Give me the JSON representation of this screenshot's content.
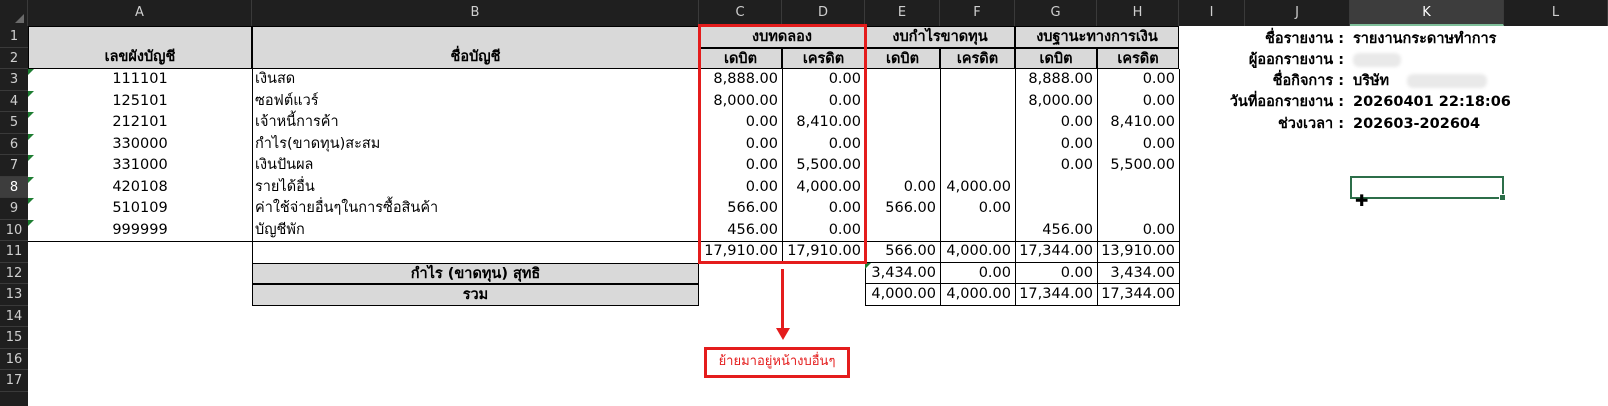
{
  "columns": [
    "A",
    "B",
    "C",
    "D",
    "E",
    "F",
    "G",
    "H",
    "I",
    "J",
    "K",
    "L"
  ],
  "rows": [
    "1",
    "2",
    "3",
    "4",
    "5",
    "6",
    "7",
    "8",
    "9",
    "10",
    "11",
    "12",
    "13",
    "14",
    "15",
    "16",
    "17"
  ],
  "selected_column": "K",
  "selected_row": "8",
  "header": {
    "account_no": "เลขผังบัญชี",
    "account_name": "ชื่อบัญชี",
    "trial_balance": "งบทดลอง",
    "profit_loss": "งบกำไรขาดทุน",
    "balance_sheet": "งบฐานะทางการเงิน",
    "debit": "เดบิต",
    "credit": "เครดิต"
  },
  "accounts": [
    {
      "code": "111101",
      "name": "เงินสด",
      "tb_dr": "8,888.00",
      "tb_cr": "0.00",
      "pl_dr": "",
      "pl_cr": "",
      "bs_dr": "8,888.00",
      "bs_cr": "0.00"
    },
    {
      "code": "125101",
      "name": "ซอฟต์แวร์",
      "tb_dr": "8,000.00",
      "tb_cr": "0.00",
      "pl_dr": "",
      "pl_cr": "",
      "bs_dr": "8,000.00",
      "bs_cr": "0.00"
    },
    {
      "code": "212101",
      "name": "เจ้าหนี้การค้า",
      "tb_dr": "0.00",
      "tb_cr": "8,410.00",
      "pl_dr": "",
      "pl_cr": "",
      "bs_dr": "0.00",
      "bs_cr": "8,410.00"
    },
    {
      "code": "330000",
      "name": "กำไร(ขาดทุน)สะสม",
      "tb_dr": "0.00",
      "tb_cr": "0.00",
      "pl_dr": "",
      "pl_cr": "",
      "bs_dr": "0.00",
      "bs_cr": "0.00"
    },
    {
      "code": "331000",
      "name": "เงินปันผล",
      "tb_dr": "0.00",
      "tb_cr": "5,500.00",
      "pl_dr": "",
      "pl_cr": "",
      "bs_dr": "0.00",
      "bs_cr": "5,500.00"
    },
    {
      "code": "420108",
      "name": "รายได้อื่น",
      "tb_dr": "0.00",
      "tb_cr": "4,000.00",
      "pl_dr": "0.00",
      "pl_cr": "4,000.00",
      "bs_dr": "",
      "bs_cr": ""
    },
    {
      "code": "510109",
      "name": "ค่าใช้จ่ายอื่นๆในการซื้อสินค้า",
      "tb_dr": "566.00",
      "tb_cr": "0.00",
      "pl_dr": "566.00",
      "pl_cr": "0.00",
      "bs_dr": "",
      "bs_cr": ""
    },
    {
      "code": "999999",
      "name": "บัญชีพัก",
      "tb_dr": "456.00",
      "tb_cr": "0.00",
      "pl_dr": "",
      "pl_cr": "",
      "bs_dr": "456.00",
      "bs_cr": "0.00"
    }
  ],
  "totals": {
    "tb_dr": "17,910.00",
    "tb_cr": "17,910.00",
    "pl_dr": "566.00",
    "pl_cr": "4,000.00",
    "bs_dr": "17,344.00",
    "bs_cr": "13,910.00"
  },
  "net_profit": {
    "label": "กำไร (ขาดทุน) สุทธิ",
    "pl_dr": "3,434.00",
    "pl_cr": "0.00",
    "bs_dr": "0.00",
    "bs_cr": "3,434.00"
  },
  "grand_total": {
    "label": "รวม",
    "pl_dr": "4,000.00",
    "pl_cr": "4,000.00",
    "bs_dr": "17,344.00",
    "bs_cr": "17,344.00"
  },
  "report_info": {
    "report_name_label": "ชื่อรายงาน :",
    "report_name": "รายงานกระดาษทำการ",
    "issuer_label": "ผู้ออกรายงาน :",
    "company_label": "ชื่อกิจการ :",
    "company": "บริษัท",
    "issue_date_label": "วันที่ออกรายงาน :",
    "issue_date": "20260401 22:18:06",
    "period_label": "ช่วงเวลา :",
    "period": "202603-202604"
  },
  "annotation": {
    "note": "ย้ายมาอยู่หน้างบอื่นๆ",
    "color": "#e41c1c"
  }
}
